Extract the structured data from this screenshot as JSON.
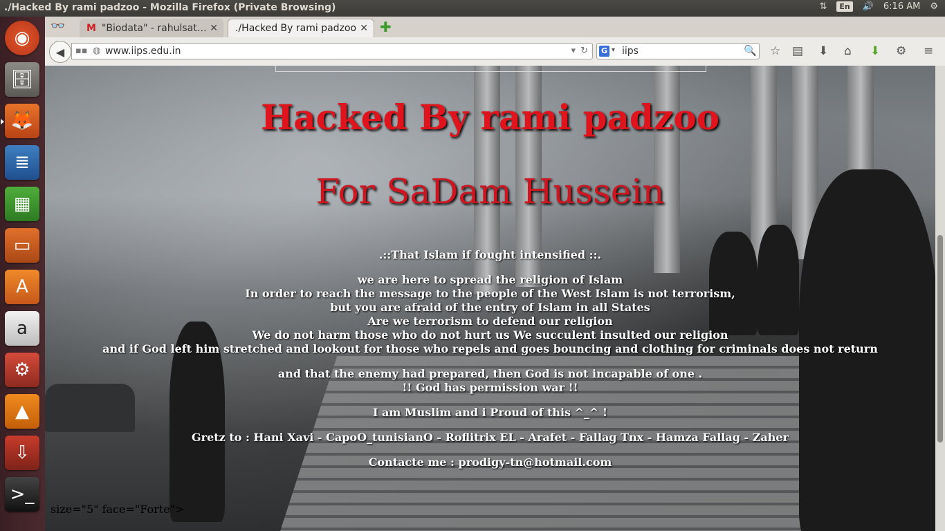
{
  "window": {
    "title": "./Hacked By rami padzoo - Mozilla Firefox (Private Browsing)",
    "keyboard": "En",
    "time": "6:16 AM"
  },
  "tabs": [
    {
      "label": "\"Biodata\" - rahulsat…",
      "icon": "gmail-icon"
    },
    {
      "label": "./Hacked By rami padzoo",
      "icon": "none"
    }
  ],
  "navbar": {
    "url": "www.iips.edu.in",
    "search_value": "iips",
    "search_engine": "G"
  },
  "page": {
    "headline": "Hacked By rami padzoo",
    "subheadline": "For SaDam Hussein",
    "lines": [
      ".::That Islam if fought intensified ::.",
      "we are here to spread the religion of Islam",
      "In order to reach the message to the people of the West Islam is not terrorism,",
      "but you are afraid of the entry of Islam in all States",
      "Are we terrorism to defend our religion",
      "We do not harm those who do not hurt us We succulent insulted our religion",
      "and if God left him stretched and lookout for those who repels and goes bouncing and clothing for criminals does not return",
      "and that the enemy had prepared, then God is not incapable of one .",
      "!! God has permission war !!",
      "I am Muslim and i Proud of this ^_^ !",
      "Gretz to : Hani Xavi - CapoO_tunisianO - Roflitrix EL - Arafet - Fallag Tnx - Hamza Fallag - Zaher",
      "Contacte me : prodigy-tn@hotmail.com"
    ],
    "stray_markup": "size=\"5\" face=\"Forte\">"
  },
  "colors": {
    "headline": "#e0141c",
    "launcher": "#4b2a2e"
  }
}
